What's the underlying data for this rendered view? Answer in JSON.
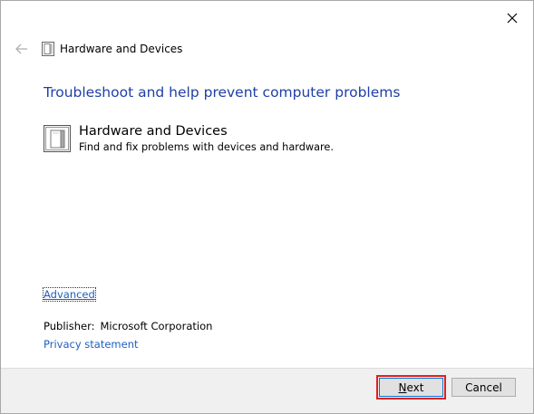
{
  "window": {
    "title": "Hardware and Devices",
    "heading": "Troubleshoot and help prevent computer problems"
  },
  "troubleshooter": {
    "name": "Hardware and Devices",
    "description": "Find and fix problems with devices and hardware."
  },
  "links": {
    "advanced": "Advanced",
    "privacy": "Privacy statement"
  },
  "publisher": {
    "label": "Publisher:",
    "value": "Microsoft Corporation"
  },
  "buttons": {
    "next_accel": "N",
    "next_rest": "ext",
    "cancel": "Cancel"
  },
  "icons": {
    "back": "back-arrow-icon",
    "close": "close-icon",
    "troubleshooter": "hardware-device-icon"
  },
  "colors": {
    "heading": "#1f3fa8",
    "link": "#1f5fc0",
    "highlight": "#e02020"
  }
}
